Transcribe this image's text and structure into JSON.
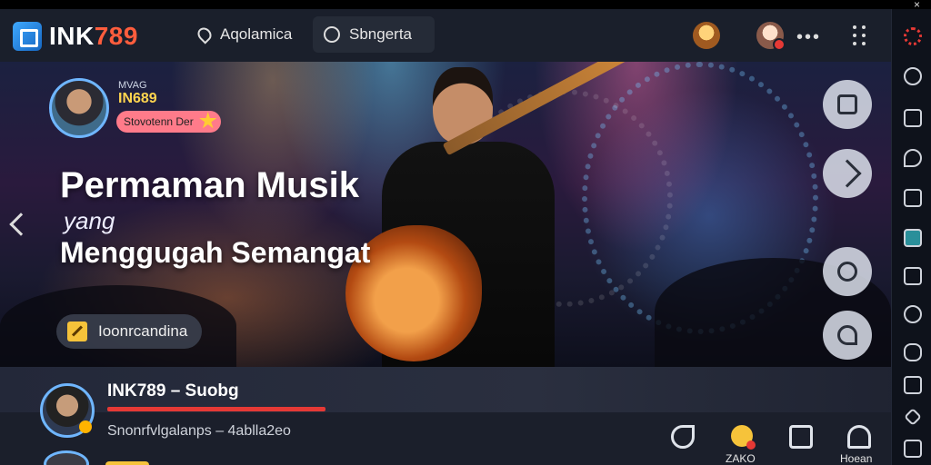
{
  "window": {
    "close_glyph": "×"
  },
  "brand": {
    "name_part1": "INK",
    "name_part2": "789",
    "accent": "#ff5d3d",
    "icon": "logo-mark"
  },
  "topbar": {
    "nav": [
      {
        "label": "Aqolamica",
        "icon": "location-pin-icon"
      },
      {
        "label": "Sbngerta",
        "icon": "search-icon"
      }
    ],
    "more_glyph": "•••",
    "icons": [
      "user-avatar",
      "notification-avatar",
      "more-icon",
      "apps-grid-icon"
    ]
  },
  "hero": {
    "profile": {
      "tag": "MVAG",
      "name": "IN689",
      "badge": "Stovotenn Der"
    },
    "headline": {
      "line1": "Permaman Musik",
      "line2": "yang",
      "line3": "Menggugah Semangat"
    },
    "cta_label": "Ioonrcandina",
    "side_buttons": [
      "playlist-icon",
      "share-icon",
      "link-icon",
      "music-note-icon"
    ],
    "nav_prev_icon": "chevron-left-icon"
  },
  "bottom": {
    "title": "INK789 – Suobg",
    "subtitle": "Snonrfvlgalanps – 4ablla2eo",
    "progress": 0.75,
    "actions": [
      {
        "label": "",
        "icon": "pin-icon"
      },
      {
        "label": "ZAKO",
        "icon": "notification-icon"
      },
      {
        "label": "",
        "icon": "library-icon"
      },
      {
        "label": "Hoean",
        "icon": "home-icon"
      }
    ]
  },
  "rightbar": {
    "icons": [
      "settings-gear-icon",
      "gear-icon",
      "window-icon",
      "chat-icon",
      "crop-icon",
      "monitor-icon",
      "media-icon",
      "search-icon",
      "gamepad-icon",
      "upload-icon",
      "diamond-icon",
      "expand-icon"
    ]
  },
  "colors": {
    "accent_red": "#e53935",
    "accent_blue": "#6fb6ff",
    "gold": "#f6c33a"
  }
}
